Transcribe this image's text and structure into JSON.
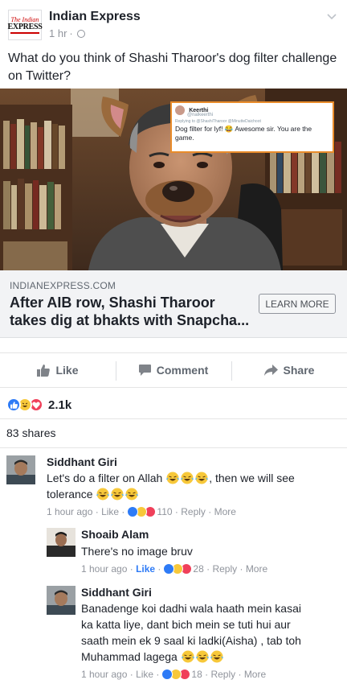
{
  "post": {
    "page_name": "Indian Express",
    "logo_line1": "The Indian",
    "logo_line2": "EXPRESS",
    "time": "1 hr",
    "meta_dot": "·",
    "text": "What do you think of Shashi Tharoor's dog filter challenge on Twitter?"
  },
  "tweet": {
    "user": "Keerthi",
    "handle": "@nalkeerthi",
    "reply_to": "Replying to @ShashiTharoor @MinutteDaichoot",
    "text": "Dog filter for lyf! 😂 Awesome sir. You are the game."
  },
  "link": {
    "domain": "INDIANEXPRESS.COM",
    "title": "After AIB row, Shashi Tharoor takes dig at bhakts with Snapcha...",
    "cta": "LEARN MORE"
  },
  "actions": {
    "like": "Like",
    "comment": "Comment",
    "share": "Share"
  },
  "reactions": {
    "count": "2.1k"
  },
  "shares": "83 shares",
  "comments": [
    {
      "name": "Siddhant Giri",
      "text_a": "Let's do a filter on Allah",
      "text_b": ", then we will see",
      "text_c": "tolerance",
      "time": "1 hour ago",
      "like": "Like",
      "reaction_count": "110",
      "reply": "Reply",
      "more": "More"
    },
    {
      "name": "Shoaib Alam",
      "text": "There's no image bruv",
      "time": "1 hour ago",
      "like": "Like",
      "reaction_count": "28",
      "reply": "Reply",
      "more": "More"
    },
    {
      "name": "Siddhant Giri",
      "line1": "Banadenge koi dadhi wala haath mein kasai",
      "line2": "ka katta liye, dant bich mein se tuti hui aur",
      "line3": "saath mein ek 9 saal ki ladki(Aisha) , tab toh",
      "line4": "Muhammad lagega",
      "time": "1 hour ago",
      "like": "Like",
      "reaction_count": "18",
      "reply": "Reply",
      "more": "More"
    }
  ],
  "colors": {
    "link_blue": "#2e7bf6",
    "text": "#1d2129",
    "meta_grey": "#90949c"
  }
}
